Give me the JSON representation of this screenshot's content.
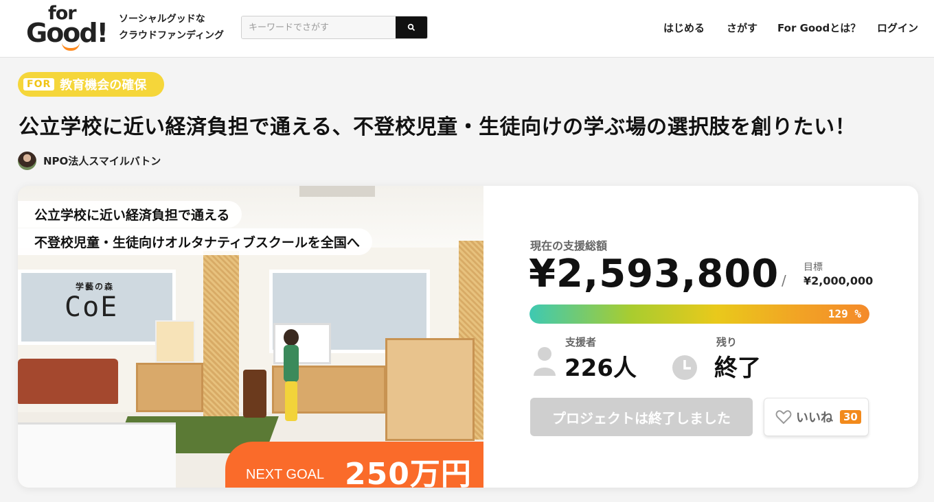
{
  "header": {
    "logo_top": "for",
    "logo_bottom": "Good!",
    "tagline_line1": "ソーシャルグッドな",
    "tagline_line2": "クラウドファンディング",
    "search": {
      "placeholder": "キーワードでさがす",
      "icon": "search-icon"
    },
    "nav": [
      "はじめる",
      "さがす",
      "For Goodとは？",
      "ログイン"
    ]
  },
  "project": {
    "tag_prefix": "FOR",
    "tag_label": "教育機会の確保",
    "title": "公立学校に近い経済負担で通える、不登校児童・生徒向けの学ぶ場の選択肢を創りたい！",
    "owner_name": "NPO法人スマイルバトン"
  },
  "hero": {
    "banner_line1": "公立学校に近い経済負担で通える",
    "banner_line2": "不登校児童・生徒向けオルタナティブスクールを全国へ",
    "sign_small": "学藝の森",
    "sign_big": "CoE",
    "next_goal_label": "NEXT GOAL",
    "next_goal_value": "250万円"
  },
  "stats": {
    "amount_label": "現在の支援総額",
    "amount": "¥2,593,800",
    "slash": "/",
    "goal_label": "目標",
    "goal_value": "¥2,000,000",
    "progress_percent": 129,
    "progress_text": "129 %",
    "supporters_label": "支援者",
    "supporters_value": "226人",
    "remaining_label": "残り",
    "remaining_value": "終了",
    "ended_button": "プロジェクトは終了しました",
    "like_label": "いいね",
    "like_count": "30",
    "colors": {
      "accent": "#fa6b2a",
      "tag": "#f5d63a",
      "like_badge": "#f28a1c"
    }
  }
}
